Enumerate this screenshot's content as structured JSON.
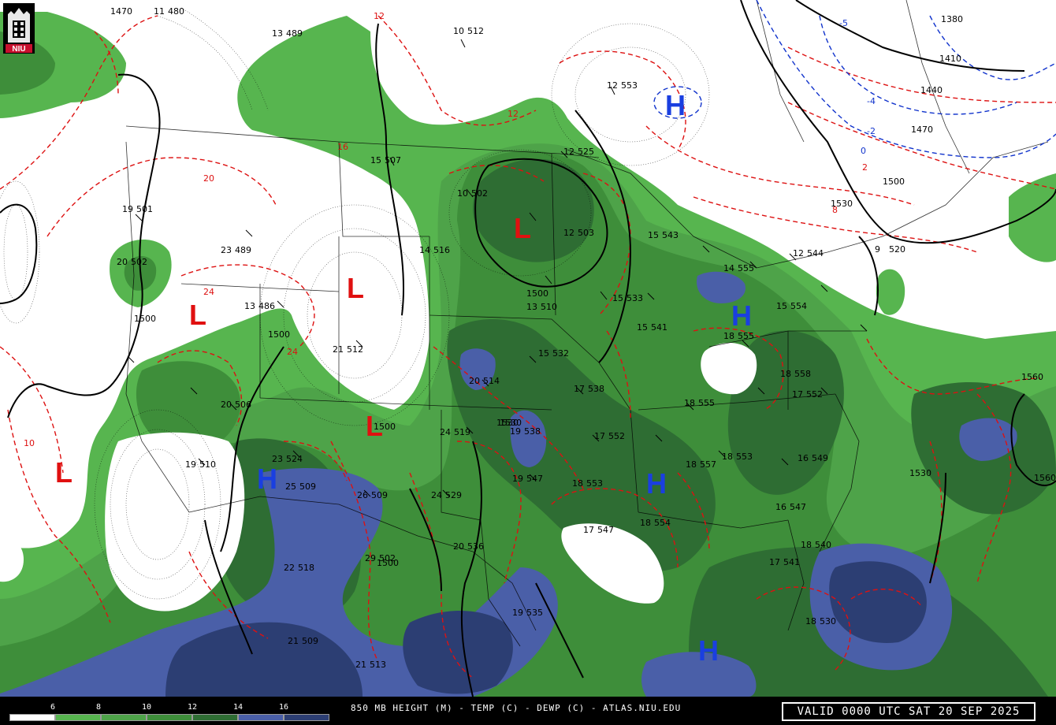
{
  "product_title": "850 MB HEIGHT (M) - TEMP (C) - DEWP (C) - ATLAS.NIU.EDU",
  "valid_time": "VALID 0000 UTC SAT 20 SEP 2025",
  "logo_text": "NIU",
  "colors": {
    "background": "#ffffff",
    "green_light": "#57b54f",
    "green_mid": "#3e8e3a",
    "green_dark": "#2e6d33",
    "green_darkest": "#24552a",
    "blue_mid": "#4a5fa8",
    "blue_dark": "#2c3e73",
    "temp_contours": "#dd1111",
    "height_contours": "#000000",
    "neg_temp": "#1133cc"
  },
  "dewpoint_scale": {
    "labels": [
      "6",
      "8",
      "10",
      "12",
      "14",
      "16"
    ],
    "fills": [
      "#ffffff",
      "#57b54f",
      "#4ea349",
      "#3e8e3a",
      "#2e6d33",
      "#4a5fa8",
      "#2c3e73"
    ]
  },
  "pressure_centers": [
    {
      "type": "L",
      "name": "low-montana"
    },
    {
      "type": "L",
      "name": "low-idaho"
    },
    {
      "type": "L",
      "name": "low-dakota"
    },
    {
      "type": "L",
      "name": "low-nebraska-colorado"
    },
    {
      "type": "L",
      "name": "low-pacific"
    },
    {
      "type": "L",
      "name": "low-north-dakota-minnesota"
    },
    {
      "type": "H",
      "name": "high-ontario"
    },
    {
      "type": "H",
      "name": "high-michigan"
    },
    {
      "type": "H",
      "name": "high-arizona"
    },
    {
      "type": "H",
      "name": "high-mississippi"
    },
    {
      "type": "H",
      "name": "high-gulf"
    }
  ],
  "station_plots": [
    {
      "t": "11",
      "h": "480"
    },
    {
      "t": "13",
      "h": "489"
    },
    {
      "t": "10",
      "h": "512"
    },
    {
      "t": "12",
      "h": "553"
    },
    {
      "t": "15",
      "h": "507"
    },
    {
      "t": "12",
      "h": "525"
    },
    {
      "t": "10",
      "h": "502"
    },
    {
      "t": "12",
      "h": "503"
    },
    {
      "t": "19",
      "h": "501"
    },
    {
      "t": "23",
      "h": "489"
    },
    {
      "t": "20",
      "h": "502"
    },
    {
      "t": "14",
      "h": "516"
    },
    {
      "t": "13",
      "h": "510"
    },
    {
      "t": "15",
      "h": "533"
    },
    {
      "t": "15",
      "h": "541"
    },
    {
      "t": "15",
      "h": "543"
    },
    {
      "t": "14",
      "h": "555"
    },
    {
      "t": "15",
      "h": "554"
    },
    {
      "t": "18",
      "h": "555"
    },
    {
      "t": "12",
      "h": "544"
    },
    {
      "t": "9",
      "h": "520"
    },
    {
      "t": "20",
      "h": "514"
    },
    {
      "t": "15",
      "h": "532"
    },
    {
      "t": "17",
      "h": "538"
    },
    {
      "t": "18",
      "h": "555"
    },
    {
      "t": "18",
      "h": "558"
    },
    {
      "t": "17",
      "h": "552"
    },
    {
      "t": "20",
      "h": "506"
    },
    {
      "t": "19",
      "h": "510"
    },
    {
      "t": "23",
      "h": "524"
    },
    {
      "t": "25",
      "h": "509"
    },
    {
      "t": "24",
      "h": "519"
    },
    {
      "t": "19",
      "h": "538"
    },
    {
      "t": "17",
      "h": "552"
    },
    {
      "t": "19",
      "h": "547"
    },
    {
      "t": "18",
      "h": "553"
    },
    {
      "t": "18",
      "h": "557"
    },
    {
      "t": "18",
      "h": "553"
    },
    {
      "t": "16",
      "h": "549"
    },
    {
      "t": "26",
      "h": "509"
    },
    {
      "t": "24",
      "h": "529"
    },
    {
      "t": "18",
      "h": "554"
    },
    {
      "t": "17",
      "h": "547"
    },
    {
      "t": "16",
      "h": "547"
    },
    {
      "t": "18",
      "h": "540"
    },
    {
      "t": "17",
      "h": "541"
    },
    {
      "t": "22",
      "h": "518"
    },
    {
      "t": "20",
      "h": "536"
    },
    {
      "t": "29",
      "h": "502"
    },
    {
      "t": "19",
      "h": "535"
    },
    {
      "t": "21",
      "h": "509"
    },
    {
      "t": "21",
      "h": "513"
    },
    {
      "t": "18",
      "h": "530"
    },
    {
      "t": "21",
      "h": "512"
    },
    {
      "t": "13",
      "h": "486"
    }
  ]
}
